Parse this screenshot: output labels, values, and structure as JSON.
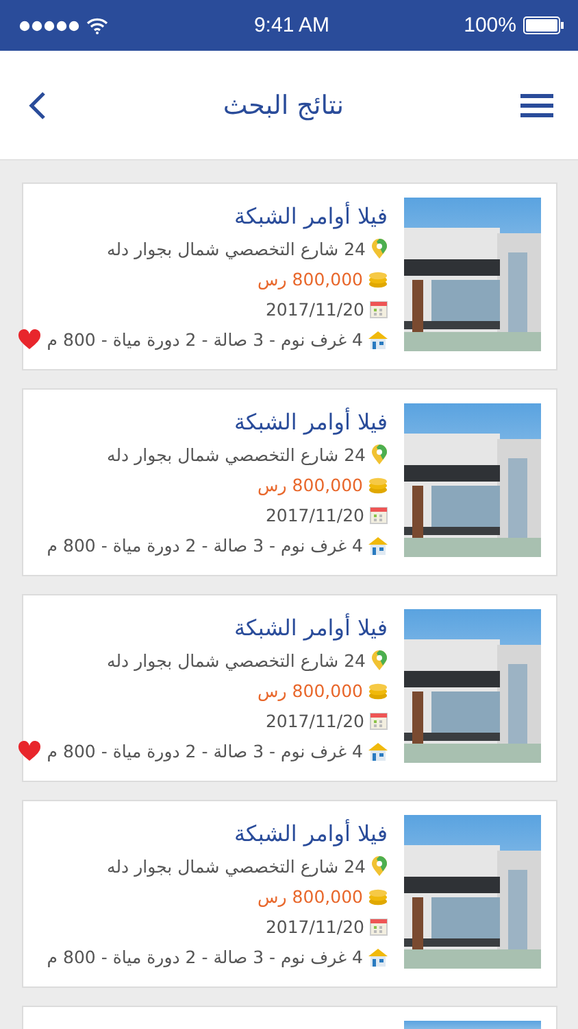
{
  "status_bar": {
    "time": "9:41 AM",
    "battery": "100%"
  },
  "header": {
    "title": "نتائج البحث"
  },
  "listings": [
    {
      "title": "فيلا أوامر الشبكة",
      "address": "24 شارع التخصصي شمال بجوار دله",
      "price": "800,000 رس",
      "date": "2017/11/20",
      "features": "4 غرف نوم - 3 صالة - 2 دورة مياة - 800 م",
      "favorite": true
    },
    {
      "title": "فيلا أوامر الشبكة",
      "address": "24 شارع التخصصي شمال بجوار دله",
      "price": "800,000 رس",
      "date": "2017/11/20",
      "features": "4 غرف نوم - 3 صالة - 2 دورة مياة - 800 م",
      "favorite": false
    },
    {
      "title": "فيلا أوامر الشبكة",
      "address": "24 شارع التخصصي شمال بجوار دله",
      "price": "800,000 رس",
      "date": "2017/11/20",
      "features": "4 غرف نوم - 3 صالة - 2 دورة مياة - 800 م",
      "favorite": true
    },
    {
      "title": "فيلا أوامر الشبكة",
      "address": "24 شارع التخصصي شمال بجوار دله",
      "price": "800,000 رس",
      "date": "2017/11/20",
      "features": "4 غرف نوم - 3 صالة - 2 دورة مياة - 800 م",
      "favorite": false
    }
  ],
  "more_below": true
}
